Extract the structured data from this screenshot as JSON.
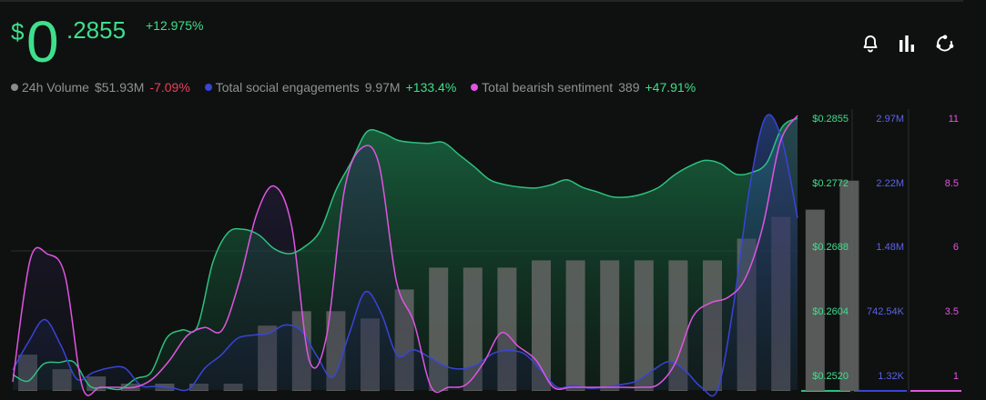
{
  "header": {
    "currency": "$",
    "price_int": "0",
    "price_dec": ".2855",
    "change": "+12.975%"
  },
  "icons": [
    "bell-icon",
    "bar-chart-icon",
    "share-network-icon"
  ],
  "legend": [
    {
      "label": "24h Volume",
      "value": "$51.93M",
      "change": "-7.09%",
      "color": "#8a8d8b",
      "change_color": "#e8405a"
    },
    {
      "label": "Total social engagements",
      "value": "9.97M",
      "change": "+133.4%",
      "color": "#3944d8",
      "change_color": "#3fdf8c"
    },
    {
      "label": "Total bearish sentiment",
      "value": "389",
      "change": "+47.91%",
      "color": "#df55e0",
      "change_color": "#3fdf8c"
    }
  ],
  "colors": {
    "price": "#3fdf8c",
    "price_line": "#2ec07f",
    "engagement": "#3944d8",
    "engagement_label": "#5b63e6",
    "sentiment": "#df55e0",
    "volume": "#5f6361"
  },
  "chart_data": {
    "type": "line",
    "x": [
      0,
      1,
      2,
      3,
      4,
      5,
      6,
      7,
      8,
      9,
      10,
      11,
      12,
      13,
      14,
      15,
      16,
      17,
      18,
      19,
      20,
      21,
      22,
      23,
      24,
      25,
      26,
      27,
      28,
      29,
      30,
      31,
      32,
      33,
      34,
      35,
      36,
      37,
      38,
      39,
      40,
      41,
      42,
      43,
      44,
      45,
      46,
      47,
      48,
      49,
      50,
      51,
      52,
      53,
      54,
      55,
      56,
      57,
      58,
      59,
      60,
      61,
      62,
      63,
      64,
      65,
      66,
      67,
      68,
      69,
      70,
      71,
      72,
      73,
      74,
      75,
      76,
      77,
      78,
      79,
      80,
      81,
      82,
      83,
      84,
      85,
      86,
      87,
      88,
      89,
      90,
      91,
      92,
      93,
      94,
      95,
      96,
      97
    ],
    "series": [
      {
        "name": "Price",
        "axis": "price",
        "values": [
          0.2539,
          0.2531,
          0.2552,
          0.2554,
          0.2554,
          0.2525,
          0.2523,
          0.2521,
          0.2534,
          0.2542,
          0.2584,
          0.2594,
          0.2598,
          0.2677,
          0.2714,
          0.2718,
          0.2711,
          0.2694,
          0.2688,
          0.2697,
          0.2717,
          0.2766,
          0.2801,
          0.2838,
          0.2837,
          0.2828,
          0.2825,
          0.2824,
          0.2825,
          0.281,
          0.2795,
          0.2779,
          0.2773,
          0.277,
          0.2769,
          0.2773,
          0.2779,
          0.277,
          0.2764,
          0.2758,
          0.2758,
          0.2762,
          0.277,
          0.2785,
          0.2796,
          0.2803,
          0.2799,
          0.2786,
          0.2788,
          0.28,
          0.2844,
          0.2855
        ]
      },
      {
        "name": "Total social engagements",
        "axis": "engagement",
        "values": [
          0.22,
          0.53,
          0.77,
          0.49,
          0.12,
          0.19,
          0.24,
          0.24,
          0.05,
          0.04,
          0.02,
          0.01,
          0.24,
          0.38,
          0.56,
          0.6,
          0.62,
          0.71,
          0.65,
          0.37,
          0.14,
          0.61,
          1.07,
          0.84,
          0.38,
          0.44,
          0.36,
          0.26,
          0.23,
          0.28,
          0.4,
          0.43,
          0.39,
          0.21,
          0.03,
          0.05,
          0.02,
          0.03,
          0.06,
          0.1,
          0.22,
          0.31,
          0.21,
          0.03,
          0.0,
          0.92,
          2.2,
          2.98,
          2.75,
          1.88
        ]
      },
      {
        "name": "Total bearish sentiment",
        "axis": "sentiment",
        "values": [
          1.3,
          5.8,
          6.0,
          5.2,
          1.1,
          1.1,
          1.1,
          1.1,
          1.4,
          2.1,
          3.0,
          3.3,
          3.2,
          5.0,
          7.5,
          8.5,
          7.0,
          2.1,
          3.0,
          8.3,
          9.9,
          9.3,
          5.0,
          3.5,
          1.1,
          1.1,
          1.2,
          2.0,
          3.1,
          2.6,
          2.1,
          1.1,
          1.1,
          1.1,
          1.1,
          1.1,
          1.1,
          1.2,
          2.0,
          3.7,
          4.2,
          4.4,
          5.1,
          7.0,
          10.1,
          11.1
        ]
      },
      {
        "name": "24h Volume",
        "axis": "volume",
        "values": [
          5,
          3,
          2,
          1,
          1,
          1,
          1,
          9,
          11,
          11,
          10,
          14,
          17,
          17,
          17,
          18,
          18,
          18,
          18,
          18,
          18,
          21,
          24,
          25,
          29
        ]
      }
    ],
    "axes": {
      "price": {
        "ticks": [
          "$0.2855",
          "$0.2772",
          "$0.2688",
          "$0.2604",
          "$0.2520"
        ],
        "ylim": [
          0.252,
          0.2855
        ]
      },
      "engagement": {
        "ticks": [
          "2.97M",
          "2.22M",
          "1.48M",
          "742.54K",
          "1.32K"
        ],
        "ylim": [
          0,
          2.97
        ]
      },
      "sentiment": {
        "ticks": [
          "11",
          "8.5",
          "6",
          "3.5",
          "1"
        ],
        "ylim": [
          1,
          11
        ]
      }
    },
    "grid": false
  }
}
